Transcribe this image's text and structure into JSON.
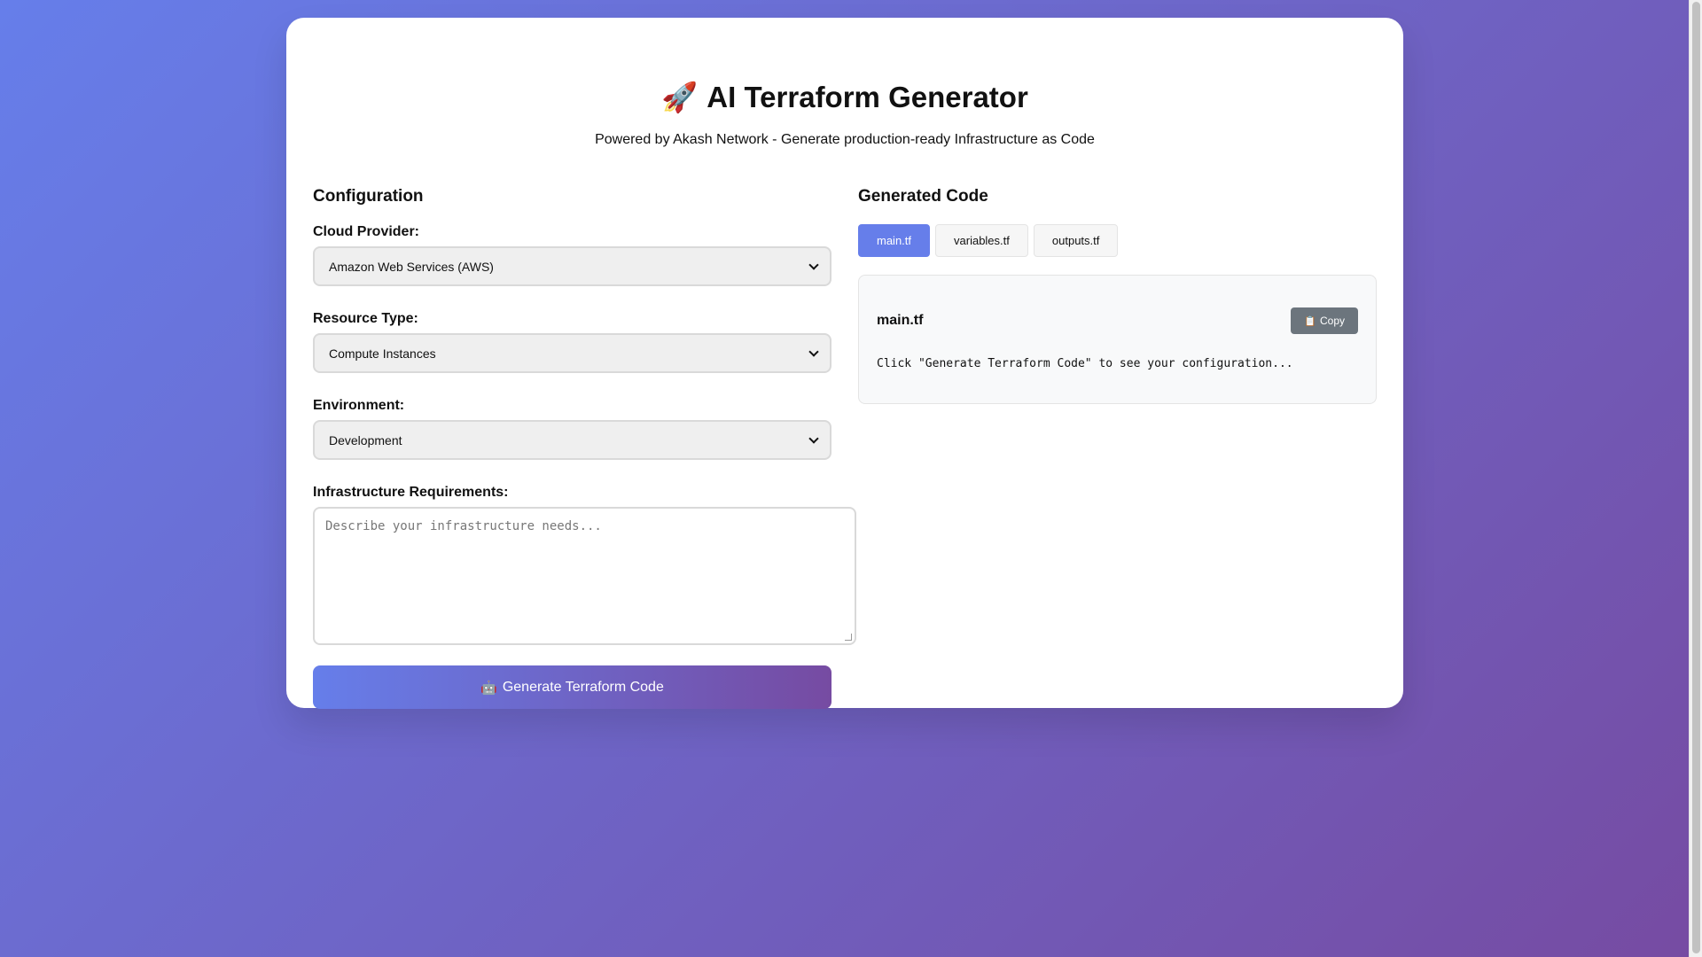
{
  "header": {
    "icon": "rocket-icon",
    "icon_glyph": "🚀",
    "title": "AI Terraform Generator",
    "subtitle": "Powered by Akash Network - Generate production-ready Infrastructure as Code"
  },
  "config": {
    "title": "Configuration",
    "cloud_provider": {
      "label": "Cloud Provider:",
      "value": "Amazon Web Services (AWS)"
    },
    "resource_type": {
      "label": "Resource Type:",
      "value": "Compute Instances"
    },
    "environment": {
      "label": "Environment:",
      "value": "Development"
    },
    "requirements": {
      "label": "Infrastructure Requirements:",
      "placeholder": "Describe your infrastructure needs...",
      "value": ""
    },
    "generate_button": {
      "icon": "robot-icon",
      "icon_glyph": "🤖",
      "label": "Generate Terraform Code"
    }
  },
  "output": {
    "title": "Generated Code",
    "tabs": [
      {
        "label": "main.tf",
        "active": true
      },
      {
        "label": "variables.tf",
        "active": false
      },
      {
        "label": "outputs.tf",
        "active": false
      }
    ],
    "panel": {
      "filename": "main.tf",
      "copy_icon": "clipboard-icon",
      "copy_icon_glyph": "📋",
      "copy_label": "Copy",
      "code": "Click \"Generate Terraform Code\" to see your configuration..."
    }
  },
  "colors": {
    "accent": "#667eea",
    "accent_end": "#764ba2",
    "copy_button": "#6c757d"
  }
}
